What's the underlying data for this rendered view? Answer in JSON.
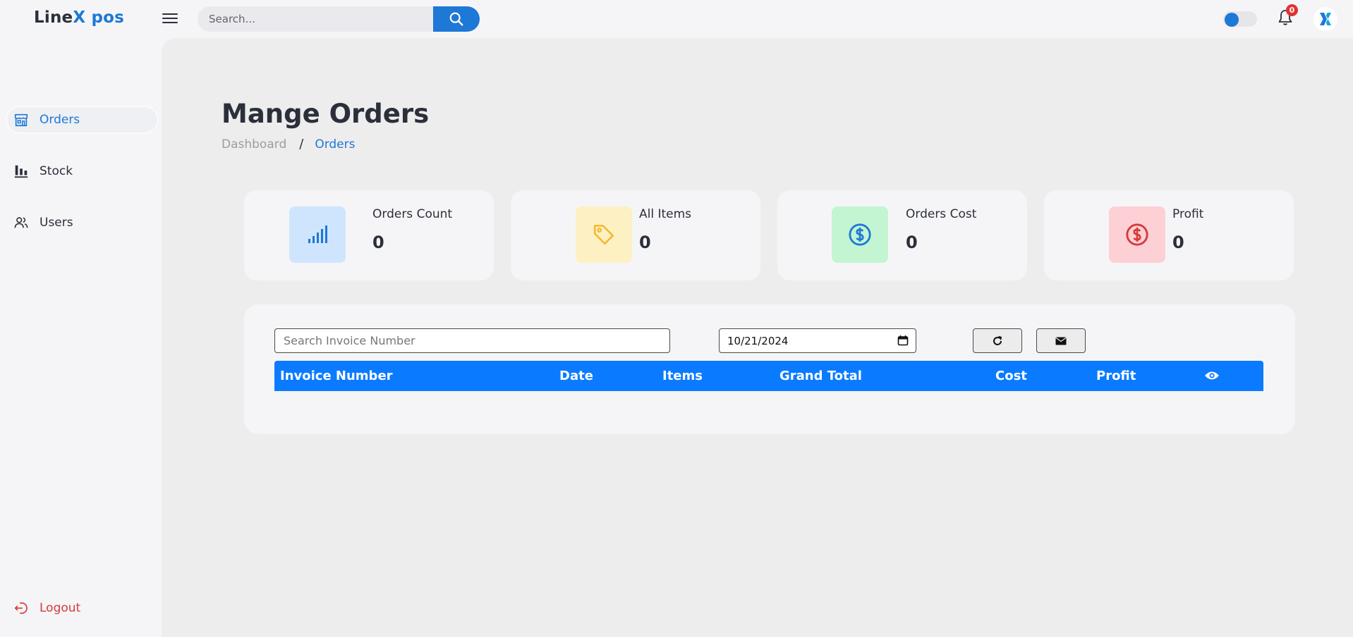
{
  "brand": {
    "part1": "Line",
    "part2": "X pos"
  },
  "topbar": {
    "search_placeholder": "Search...",
    "notification_count": "0"
  },
  "sidebar": {
    "items": [
      {
        "label": "Orders",
        "icon": "store-icon",
        "active": true
      },
      {
        "label": "Stock",
        "icon": "bar-chart-icon",
        "active": false
      },
      {
        "label": "Users",
        "icon": "users-icon",
        "active": false
      }
    ],
    "logout_label": "Logout"
  },
  "page": {
    "title": "Mange Orders",
    "breadcrumb": {
      "home": "Dashboard",
      "separator": "/",
      "current": "Orders"
    }
  },
  "stats": [
    {
      "label": "Orders Count",
      "value": "0",
      "icon": "signal-icon",
      "bg": "#cfe5fd",
      "color": "#1e78d6"
    },
    {
      "label": "All Items",
      "value": "0",
      "icon": "tag-icon",
      "bg": "#fdf1c3",
      "color": "#f5b82e"
    },
    {
      "label": "Orders Cost",
      "value": "0",
      "icon": "dollar-circle-icon",
      "bg": "#c3f5d3",
      "color": "#1e78d6"
    },
    {
      "label": "Profit",
      "value": "0",
      "icon": "dollar-circle-icon",
      "bg": "#fdd0d6",
      "color": "#d63939"
    }
  ],
  "filters": {
    "invoice_placeholder": "Search Invoice Number",
    "date_value": "10/21/2024"
  },
  "table": {
    "columns": [
      "Invoice Number",
      "Date",
      "Items",
      "Grand Total",
      "Cost",
      "Profit"
    ],
    "rows": []
  },
  "colors": {
    "accent": "#1e78d6",
    "table_header": "#0a7bff",
    "danger": "#d63939"
  }
}
